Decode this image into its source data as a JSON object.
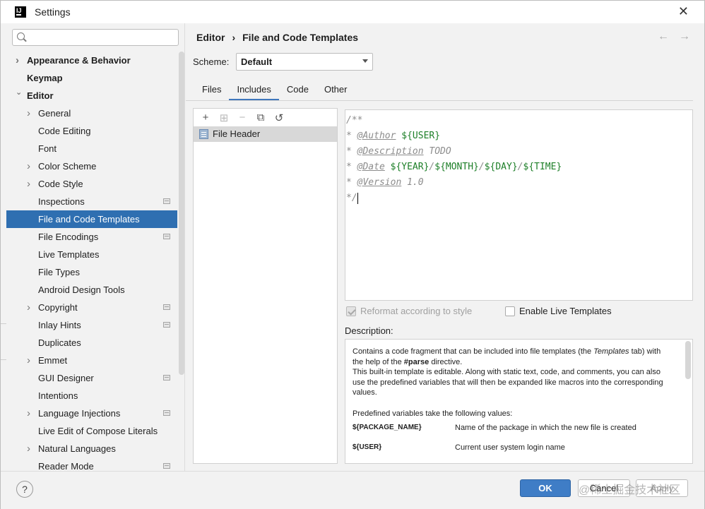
{
  "window": {
    "title": "Settings",
    "logo_text": "IJ"
  },
  "search": {
    "placeholder": ""
  },
  "sidebar": {
    "items": [
      {
        "label": "Appearance & Behavior",
        "bold": true,
        "level": 0,
        "chevron": "right"
      },
      {
        "label": "Keymap",
        "bold": true,
        "level": 0,
        "chevron": ""
      },
      {
        "label": "Editor",
        "bold": true,
        "level": 0,
        "chevron": "down"
      },
      {
        "label": "General",
        "level": 1,
        "chevron": "right"
      },
      {
        "label": "Code Editing",
        "level": 1,
        "chevron": ""
      },
      {
        "label": "Font",
        "level": 1,
        "chevron": ""
      },
      {
        "label": "Color Scheme",
        "level": 1,
        "chevron": "right"
      },
      {
        "label": "Code Style",
        "level": 1,
        "chevron": "right"
      },
      {
        "label": "Inspections",
        "level": 1,
        "chevron": "",
        "project_icon": true
      },
      {
        "label": "File and Code Templates",
        "level": 1,
        "chevron": "",
        "selected": true
      },
      {
        "label": "File Encodings",
        "level": 1,
        "chevron": "",
        "project_icon": true
      },
      {
        "label": "Live Templates",
        "level": 1,
        "chevron": ""
      },
      {
        "label": "File Types",
        "level": 1,
        "chevron": ""
      },
      {
        "label": "Android Design Tools",
        "level": 1,
        "chevron": ""
      },
      {
        "label": "Copyright",
        "level": 1,
        "chevron": "right",
        "project_icon": true
      },
      {
        "label": "Inlay Hints",
        "level": 1,
        "chevron": "",
        "project_icon": true
      },
      {
        "label": "Duplicates",
        "level": 1,
        "chevron": ""
      },
      {
        "label": "Emmet",
        "level": 1,
        "chevron": "right"
      },
      {
        "label": "GUI Designer",
        "level": 1,
        "chevron": "",
        "project_icon": true
      },
      {
        "label": "Intentions",
        "level": 1,
        "chevron": ""
      },
      {
        "label": "Language Injections",
        "level": 1,
        "chevron": "right",
        "project_icon": true
      },
      {
        "label": "Live Edit of Compose Literals",
        "level": 1,
        "chevron": ""
      },
      {
        "label": "Natural Languages",
        "level": 1,
        "chevron": "right"
      },
      {
        "label": "Reader Mode",
        "level": 1,
        "chevron": "",
        "project_icon": true
      }
    ]
  },
  "breadcrumb": {
    "parent": "Editor",
    "separator": "›",
    "current": "File and Code Templates"
  },
  "nav": {
    "back": "←",
    "forward": "→"
  },
  "scheme": {
    "label": "Scheme:",
    "value": "Default"
  },
  "tabs": [
    {
      "label": "Files",
      "active": false
    },
    {
      "label": "Includes",
      "active": true
    },
    {
      "label": "Code",
      "active": false
    },
    {
      "label": "Other",
      "active": false
    }
  ],
  "list": {
    "toolbar": {
      "add": "+",
      "copy": "⧉",
      "reset": "↺"
    },
    "items": [
      "File Header"
    ]
  },
  "editor": {
    "open": "/**",
    "author_tag": "@Author",
    "author_var": "${USER}",
    "desc_tag": "@Description",
    "desc_value": "TODO",
    "date_tag": "@Date",
    "date_year": "${YEAR}",
    "date_month": "${MONTH}",
    "date_day": "${DAY}",
    "date_time": "${TIME}",
    "version_tag": "@Version",
    "version_value": "1.0",
    "close": "*/",
    "star": "*",
    "slash": "/"
  },
  "options": {
    "reformat_label": "Reformat according to style",
    "reformat_checked": true,
    "live_label": "Enable Live Templates",
    "live_checked": false
  },
  "description": {
    "label": "Description:",
    "p1_a": "Contains a code fragment that can be included into file templates (the ",
    "p1_b": "Templates",
    "p1_c": " tab) with the help of the ",
    "p1_d": "#parse",
    "p1_e": " directive.",
    "p1_f": "This built-in template is editable. Along with static text, code, and comments, you can also use the predefined variables that will then be expanded like macros into the corresponding values.",
    "p2": "Predefined variables take the following values:",
    "vars": [
      {
        "name": "${PACKAGE_NAME}",
        "desc": "Name of the package in which the new file is created"
      },
      {
        "name": "${USER}",
        "desc": "Current user system login name"
      }
    ]
  },
  "footer": {
    "help": "?",
    "ok": "OK",
    "cancel": "Cancel",
    "apply": "Apply",
    "watermark": "@稀土掘金技术社区"
  },
  "colors": {
    "accent": "#2f6fb1",
    "ok_button": "#3f7dc6",
    "template_var": "#1d7f28"
  }
}
